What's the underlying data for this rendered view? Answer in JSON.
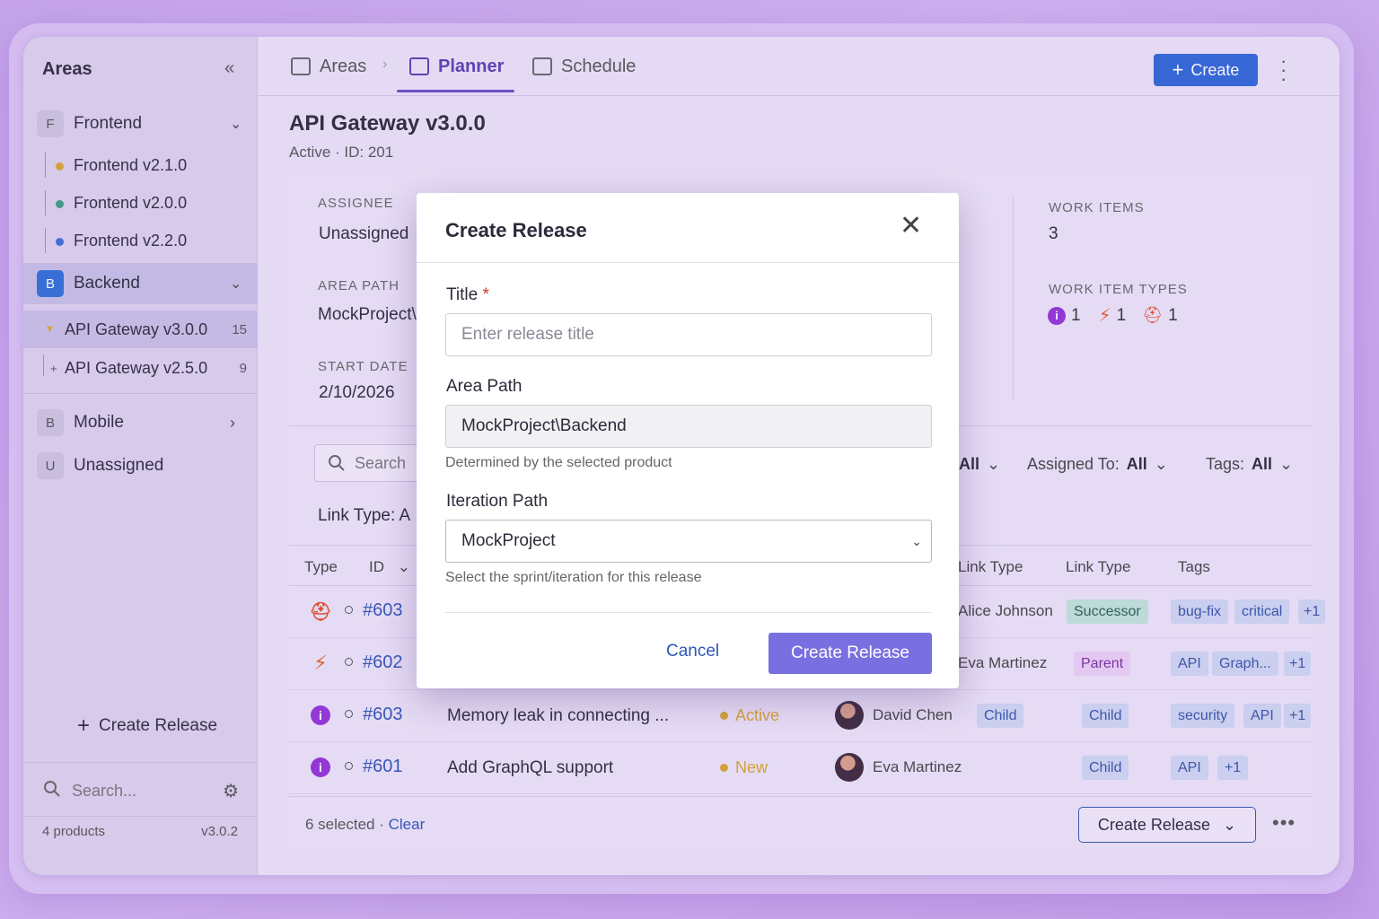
{
  "sidebar": {
    "title": "Areas",
    "groups": [
      {
        "badge": "F",
        "label": "Frontend"
      },
      {
        "badge": "B",
        "label": "Backend"
      },
      {
        "badge": "B",
        "label": "Mobile"
      },
      {
        "badge": "U",
        "label": "Unassigned"
      }
    ],
    "frontend_items": [
      {
        "label": "Frontend v2.1.0",
        "color": "#d8a530"
      },
      {
        "label": "Frontend v2.0.0",
        "color": "#3e9c82"
      },
      {
        "label": "Frontend v2.2.0",
        "color": "#3d6fd8"
      }
    ],
    "backend_items": [
      {
        "label": "API Gateway v3.0.0",
        "count": "15"
      },
      {
        "label": "API Gateway v2.5.0",
        "count": "9"
      }
    ],
    "create_release": "Create Release",
    "search_placeholder": "Search...",
    "footer_products": "4 products",
    "footer_version": "v3.0.2"
  },
  "topbar": {
    "tabs": [
      "Areas",
      "Planner",
      "Schedule"
    ],
    "create_label": "Create"
  },
  "page": {
    "title": "API Gateway v3.0.0",
    "subtitle": "Active · ID: 201"
  },
  "details": {
    "assignee_label": "ASSIGNEE",
    "assignee_value": "Unassigned",
    "area_path_label": "AREA PATH",
    "area_path_value": "MockProject\\",
    "start_date_label": "START DATE",
    "start_date_value": "2/10/2026",
    "work_items_label": "WORK ITEMS",
    "work_items_value": "3",
    "work_item_types_label": "WORK ITEM TYPES",
    "type_counts": [
      "1",
      "1",
      "1"
    ]
  },
  "filters": {
    "search_placeholder": "Search",
    "state_value": "All",
    "assigned_to_label": "Assigned To:",
    "assigned_to_value": "All",
    "tags_label": "Tags:",
    "tags_value": "All",
    "link_type_label": "Link Type:",
    "link_type_value": "A"
  },
  "table": {
    "headers": {
      "type": "Type",
      "id": "ID",
      "link_type_1": "Link Type",
      "link_type_2": "Link Type",
      "tags": "Tags"
    },
    "rows": [
      {
        "type": "bug",
        "id": "#603",
        "title": "",
        "status": "",
        "assignee": "Alice Johnson",
        "link1": "",
        "link2": "Successor",
        "tags": [
          "bug-fix",
          "critical"
        ],
        "more": "+1"
      },
      {
        "type": "feature",
        "id": "#602",
        "title": "",
        "status": "",
        "assignee": "Eva Martinez",
        "link1": "",
        "link2": "Parent",
        "tags": [
          "API",
          "Graph..."
        ],
        "more": "+1"
      },
      {
        "type": "info",
        "id": "#603",
        "title": "Memory leak in connecting ...",
        "status": "Active",
        "assignee": "David Chen",
        "link1": "Child",
        "link2": "Child",
        "tags": [
          "security",
          "API"
        ],
        "more": "+1"
      },
      {
        "type": "info",
        "id": "#601",
        "title": "Add GraphQL support",
        "status": "New",
        "assignee": "Eva Martinez",
        "link1": "",
        "link2": "Child",
        "tags": [
          "API"
        ],
        "more": "+1"
      }
    ]
  },
  "bottom_bar": {
    "selected_text": "6 selected",
    "clear_label": "Clear",
    "create_release_label": "Create Release"
  },
  "modal": {
    "title": "Create Release",
    "title_label": "Title",
    "title_placeholder": "Enter release title",
    "area_path_label": "Area Path",
    "area_path_value": "MockProject\\Backend",
    "area_path_help": "Determined by the selected product",
    "iteration_label": "Iteration Path",
    "iteration_value": "MockProject",
    "iteration_help": "Select the sprint/iteration for this release",
    "cancel_label": "Cancel",
    "submit_label": "Create Release"
  },
  "colors": {
    "accent": "#6b4fc3",
    "primary_button": "#2f66d6",
    "modal_submit": "#7a6fe0",
    "status_active": "#d8a530",
    "bug": "#e0522a",
    "feature": "#e6602a",
    "info": "#9333d6"
  }
}
